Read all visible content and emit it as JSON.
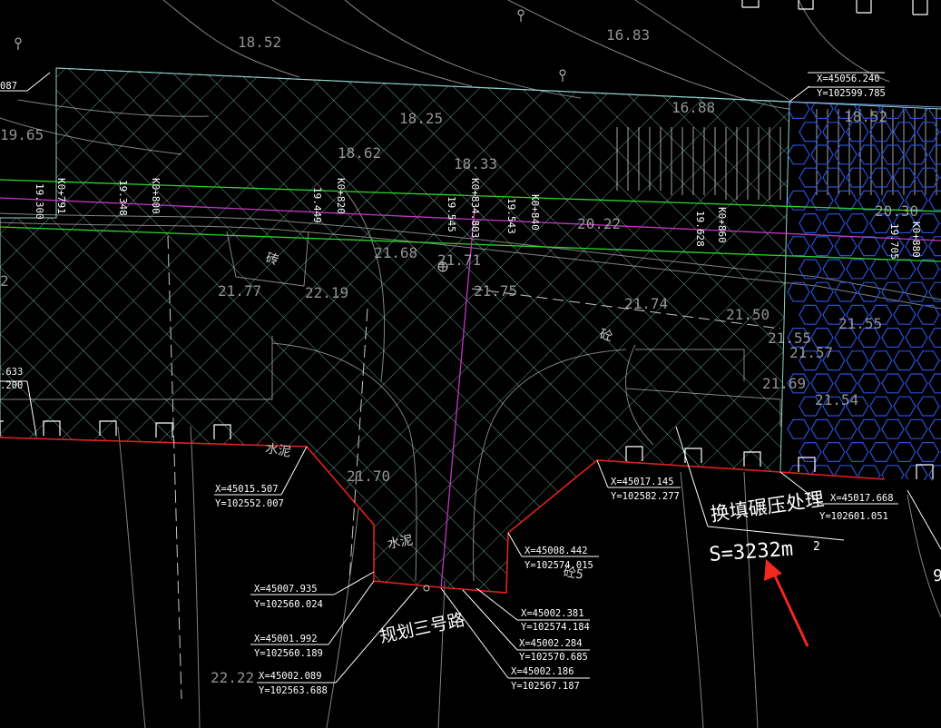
{
  "colors": {
    "background": "#000000",
    "hatch": "#8fd3c8",
    "contour": "#c8c8c8",
    "boundary": "#e0201e",
    "centerline": "#c236c2",
    "roadEdge": "#2ad62a",
    "coordText": "#ffffff",
    "hexFill": "#2a4fd6",
    "arrow": "#f0281e"
  },
  "annotation": {
    "title": "换填碾压处理",
    "area": "S=3232m",
    "area_sup": "2"
  },
  "road_name": "规划三号路",
  "stakes": {
    "s791": "K0+791",
    "s800": "K0+800",
    "s820": "K0+820",
    "s834": "K0+834.803",
    "s840": "K0+840",
    "s860": "K0+860",
    "s880": "K0+880"
  },
  "stake_elev": {
    "e791": "19.300",
    "e800": "19.348",
    "e820": "19.449",
    "e834": "19.545",
    "e840": "19.543",
    "e860": "19.628",
    "e880": "19.705"
  },
  "elevations": {
    "e1852": "18.52",
    "e1683": "16.83",
    "e1825": "18.25",
    "e1965": "19.65",
    "e1862": "18.62",
    "e1833": "18.33",
    "e1688": "16.88",
    "e1852b": "18.52",
    "e2022": "20.22",
    "e2030": "20.30",
    "e2168": "21.68",
    "e2171": "21.71",
    "e2177": "21.77",
    "e2219": "22.19",
    "e2175": "21.75",
    "e2174": "21.74",
    "e2150": "21.50",
    "e2155": "21.55",
    "e2155b": "21.55",
    "e2157": "21.57",
    "e2169": "21.69",
    "e2154": "21.54",
    "e2170": "21.70",
    "e2222": "22.22",
    "e22": "2"
  },
  "materials": {
    "m1": "砖",
    "m2": "砼",
    "m3": "水泥",
    "m4": "水泥",
    "m5": "砼5"
  },
  "coordinates": [
    {
      "x": "X=45056.240",
      "y": "Y=102599.785"
    },
    {
      "x": "X=45015.507",
      "y": "Y=102552.007"
    },
    {
      "x": "X=45017.145",
      "y": "Y=102582.277"
    },
    {
      "x": "X=45017.668",
      "y": "Y=102601.051"
    },
    {
      "x": "X=45008.442",
      "y": "Y=102574.015"
    },
    {
      "x": "X=45007.935",
      "y": "Y=102560.024"
    },
    {
      "x": "X=45002.381",
      "y": "Y=102574.184"
    },
    {
      "x": "X=45001.992",
      "y": "Y=102560.189"
    },
    {
      "x": "X=45002.284",
      "y": "Y=102570.685"
    },
    {
      "x": "X=45002.089",
      "y": "Y=102563.688"
    },
    {
      "x": "X=45002.186",
      "y": "Y=102567.187"
    }
  ],
  "edge_fragments": {
    "f1": "087",
    "f2": ".633",
    "f3": ".200",
    "f4": "9"
  }
}
